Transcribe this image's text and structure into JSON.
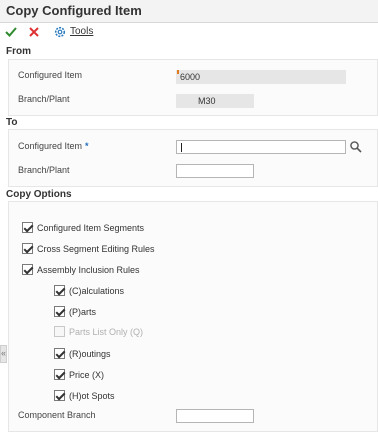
{
  "window": {
    "title": "Copy Configured Item"
  },
  "toolbar": {
    "tools_label": "Tools"
  },
  "from": {
    "heading": "From",
    "configured_item_label": "Configured Item",
    "configured_item_value": "6000",
    "branch_plant_label": "Branch/Plant",
    "branch_plant_value": "M30"
  },
  "to": {
    "heading": "To",
    "configured_item_label": "Configured Item",
    "required_mark": "*",
    "configured_item_value": "",
    "branch_plant_label": "Branch/Plant",
    "branch_plant_value": ""
  },
  "copy_options": {
    "heading": "Copy Options",
    "options": [
      {
        "label": "Configured Item Segments",
        "checked": true,
        "enabled": true
      },
      {
        "label": "Cross Segment Editing Rules",
        "checked": true,
        "enabled": true
      },
      {
        "label": "Assembly Inclusion Rules",
        "checked": true,
        "enabled": true
      },
      {
        "label": "(C)alculations",
        "checked": true,
        "enabled": true
      },
      {
        "label": "(P)arts",
        "checked": true,
        "enabled": true
      },
      {
        "label": "Parts List Only (Q)",
        "checked": false,
        "enabled": false
      },
      {
        "label": "(R)outings",
        "checked": true,
        "enabled": true
      },
      {
        "label": "Price (X)",
        "checked": true,
        "enabled": true
      },
      {
        "label": "(H)ot Spots",
        "checked": true,
        "enabled": true
      }
    ],
    "component_branch_label": "Component Branch",
    "component_branch_value": ""
  }
}
